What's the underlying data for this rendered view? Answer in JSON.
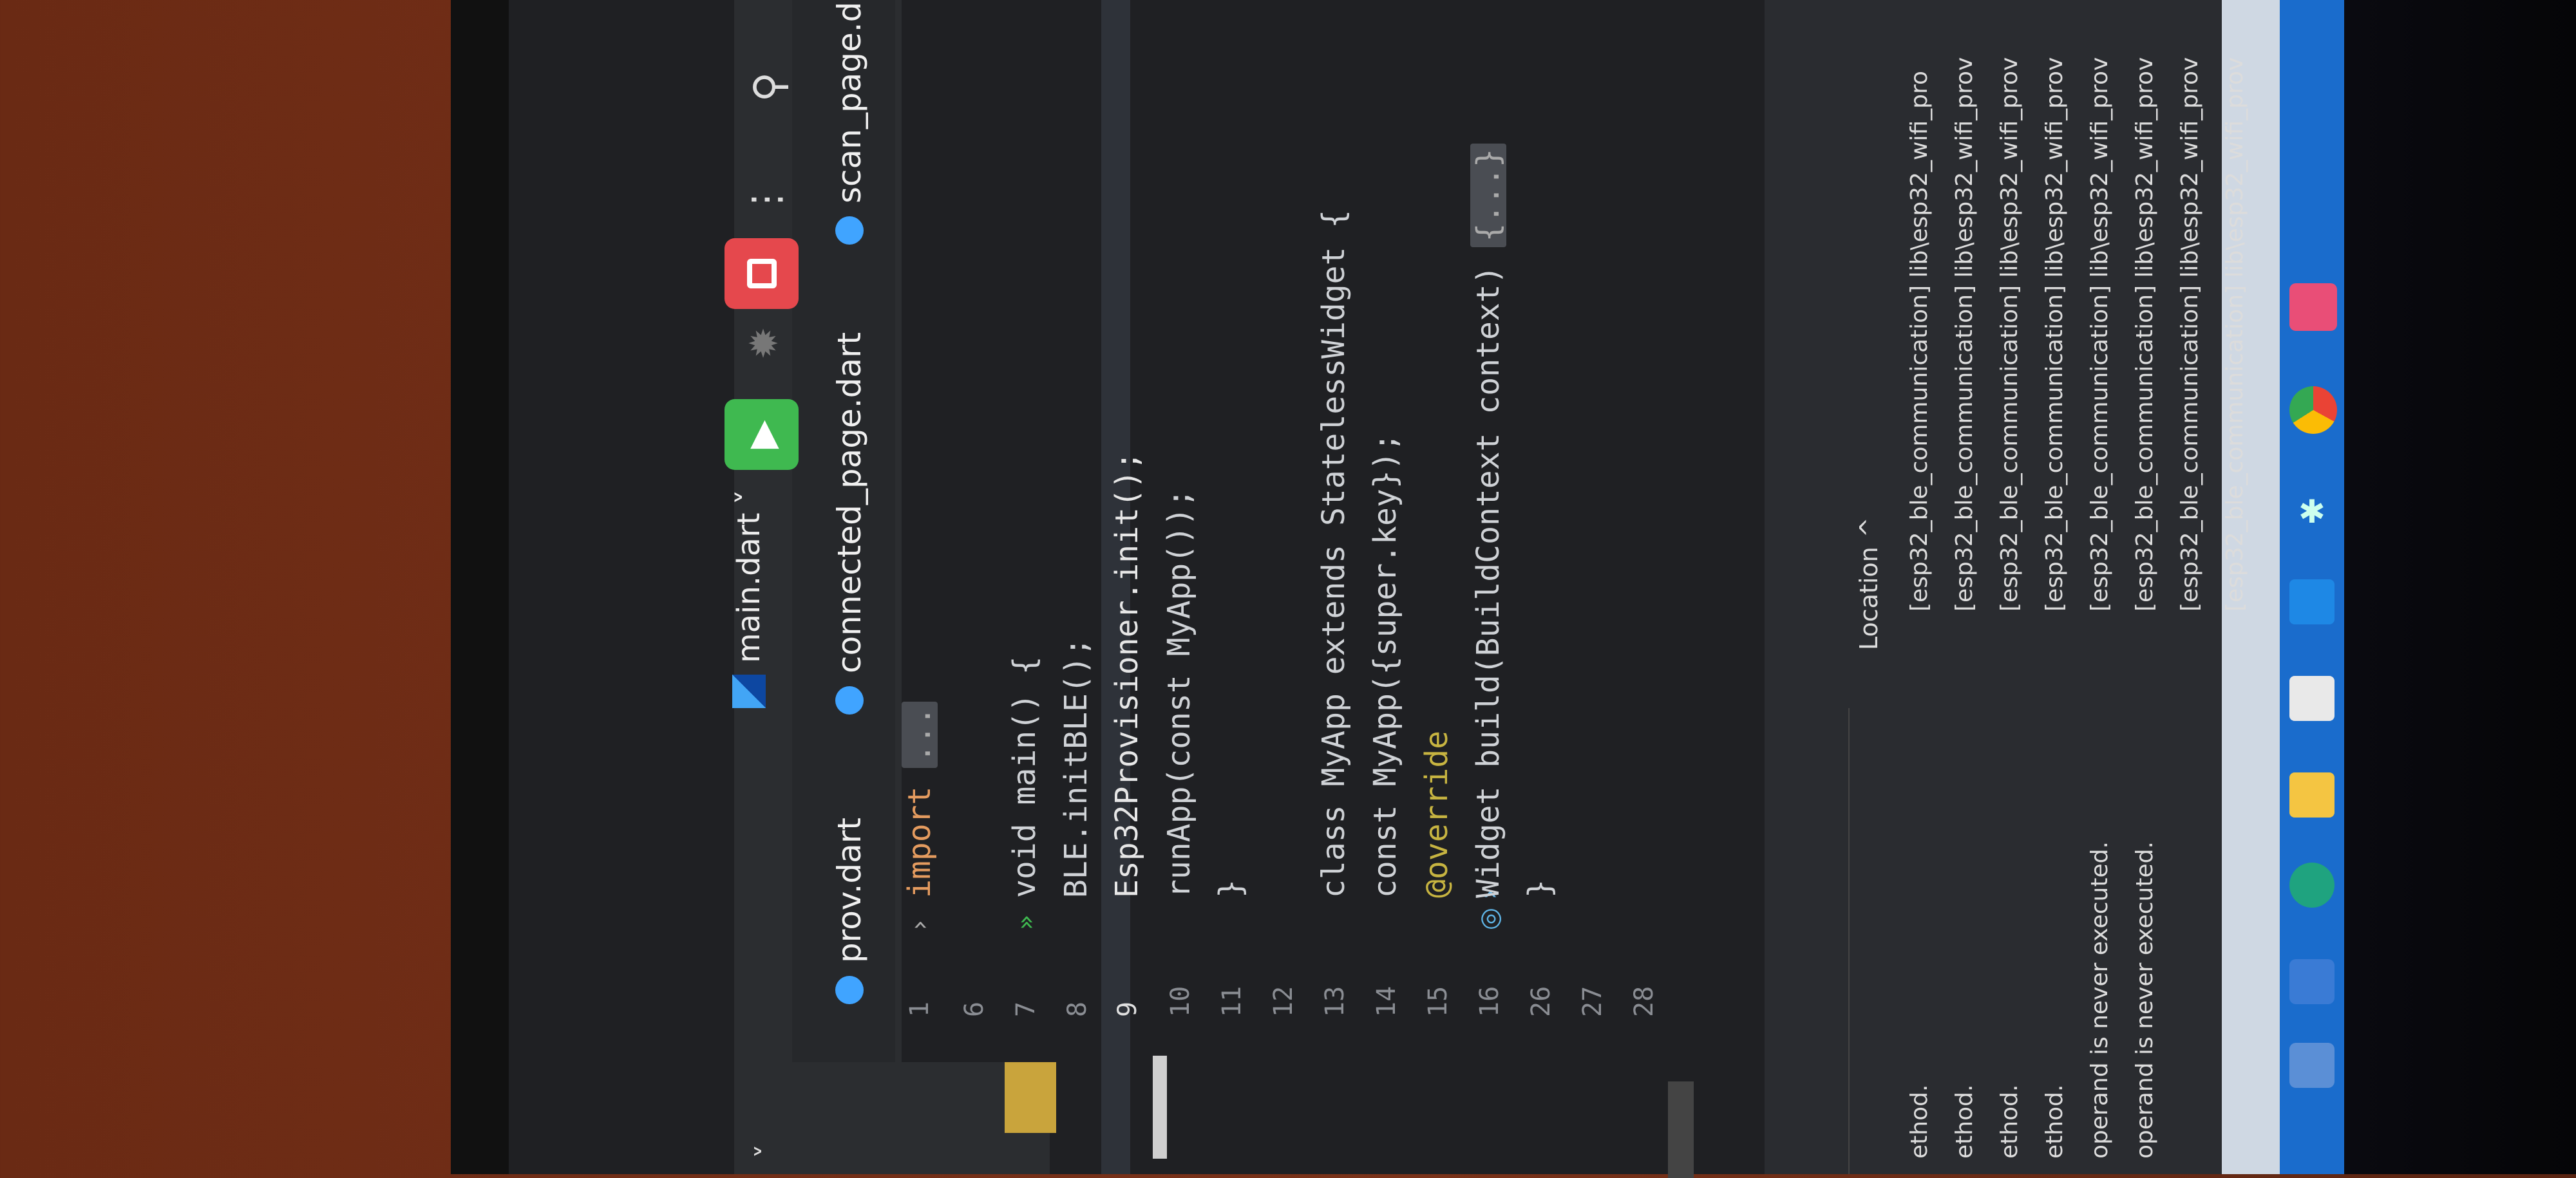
{
  "toolbar": {
    "left_chevron": "˅",
    "run_config": "main.dart",
    "run_config_chevron": "˅",
    "run_symbol": "▶",
    "debug_symbol": "✹",
    "more_symbol": "⋮",
    "user_symbol": "⚲"
  },
  "tabs": [
    "prov.dart",
    "connected_page.dart",
    "scan_page.dar"
  ],
  "editor": {
    "line_numbers": [
      "1",
      "6",
      "7",
      "8",
      "9",
      "10",
      "11",
      "12",
      "13",
      "14",
      "15",
      "16",
      "26",
      "27",
      "28"
    ],
    "lines": [
      {
        "n": "1",
        "text": "import",
        "fold": "..."
      },
      {
        "n": "6",
        "text": ""
      },
      {
        "n": "7",
        "text": "void main() {"
      },
      {
        "n": "8",
        "text": "  BLE.initBLE();"
      },
      {
        "n": "9",
        "text": "  Esp32Provisioner.init();"
      },
      {
        "n": "10",
        "text": "  runApp(const MyApp());"
      },
      {
        "n": "11",
        "text": "}"
      },
      {
        "n": "12",
        "text": ""
      },
      {
        "n": "13",
        "text": "class MyApp extends StatelessWidget {"
      },
      {
        "n": "14",
        "text": "  const MyApp({super.key});"
      },
      {
        "n": "15",
        "text": "  @override"
      },
      {
        "n": "16",
        "text": "  Widget build(BuildContext context)",
        "fold": "{...}"
      },
      {
        "n": "26",
        "text": "}"
      },
      {
        "n": "27",
        "text": ""
      },
      {
        "n": "28",
        "text": ""
      }
    ]
  },
  "problems": {
    "location_header": "Location",
    "location_sort": "^",
    "left_messages": [
      "ethod.",
      "ethod.",
      "ethod.",
      "ethod.",
      "operand is never executed.",
      "operand is never executed."
    ],
    "right_locations": [
      "[esp32_ble_communication] lib\\esp32_wifi_pro",
      "[esp32_ble_communication] lib\\esp32_wifi_prov",
      "[esp32_ble_communication] lib\\esp32_wifi_prov",
      "[esp32_ble_communication] lib\\esp32_wifi_prov",
      "[esp32_ble_communication] lib\\esp32_wifi_prov",
      "[esp32_ble_communication] lib\\esp32_wifi_prov",
      "[esp32_ble_communication] lib\\esp32_wifi_prov",
      "[esp32_ble_communication] lib\\esp32_wifi_prov"
    ]
  }
}
